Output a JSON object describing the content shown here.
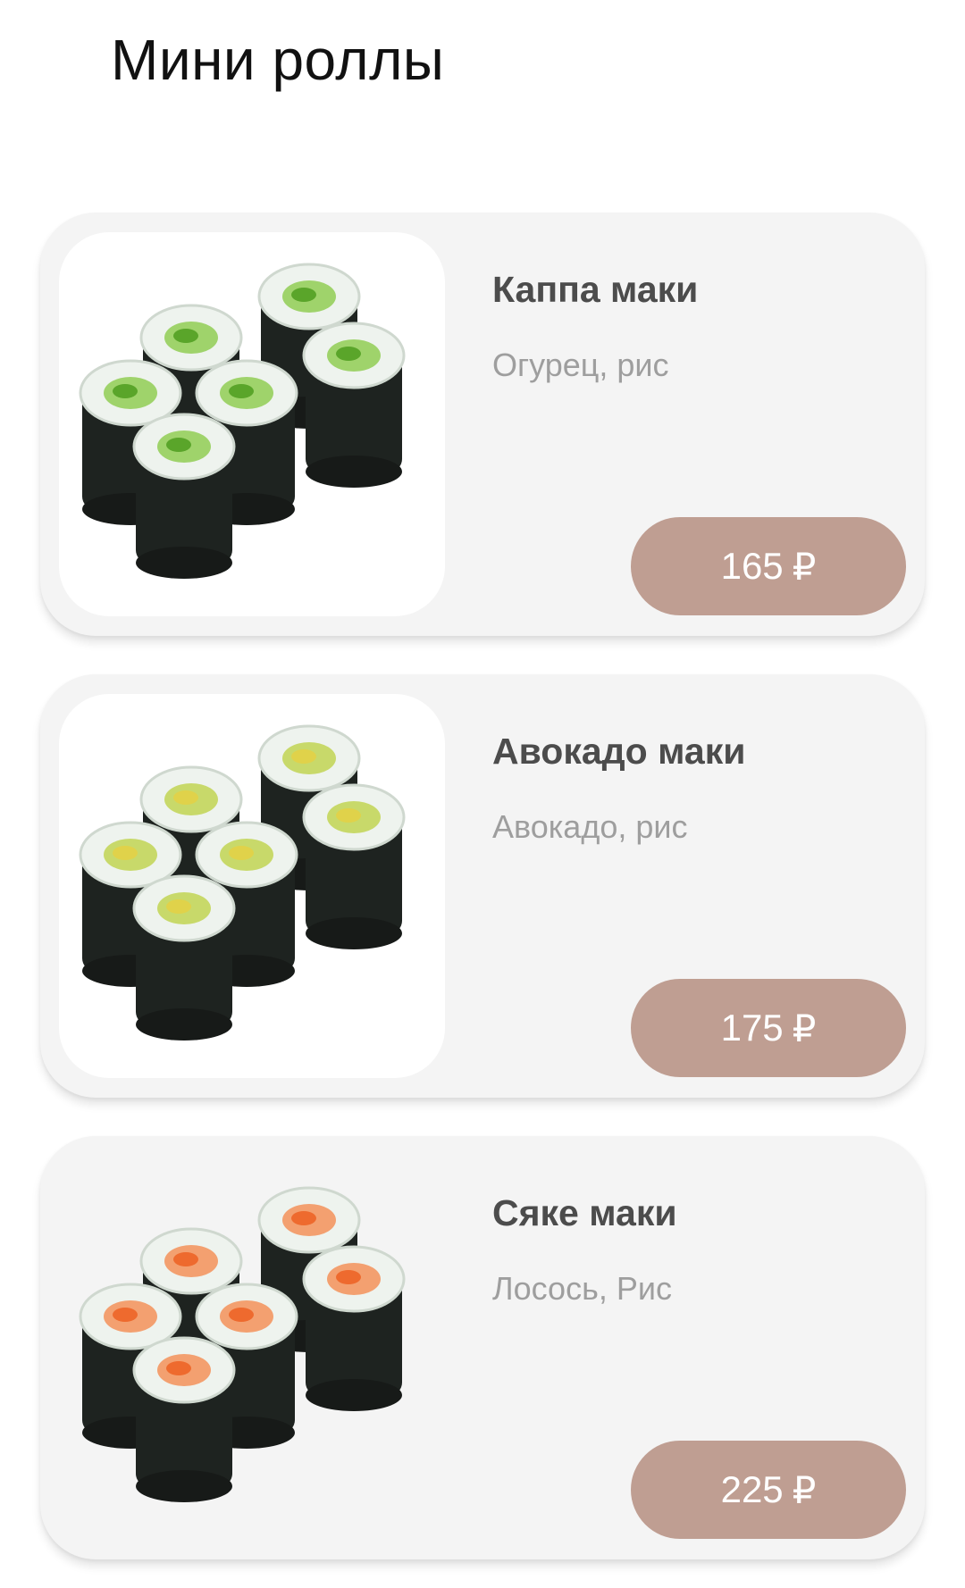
{
  "header": {
    "title": "Мини роллы"
  },
  "currency_symbol": "₽",
  "products": [
    {
      "name": "Каппа маки",
      "description": "Огурец, рис",
      "price": "165",
      "filling": "cucumber"
    },
    {
      "name": "Авокадо маки",
      "description": "Авокадо, рис",
      "price": "175",
      "filling": "avocado"
    },
    {
      "name": "Сяке маки",
      "description": "Лосось, Рис",
      "price": "225",
      "filling": "salmon"
    }
  ],
  "colors": {
    "card_background": "#f4f4f4",
    "price_button": "#bf9e92",
    "title_text": "#111111",
    "name_text": "#4c4c4c",
    "description_text": "#9e9e9e"
  }
}
